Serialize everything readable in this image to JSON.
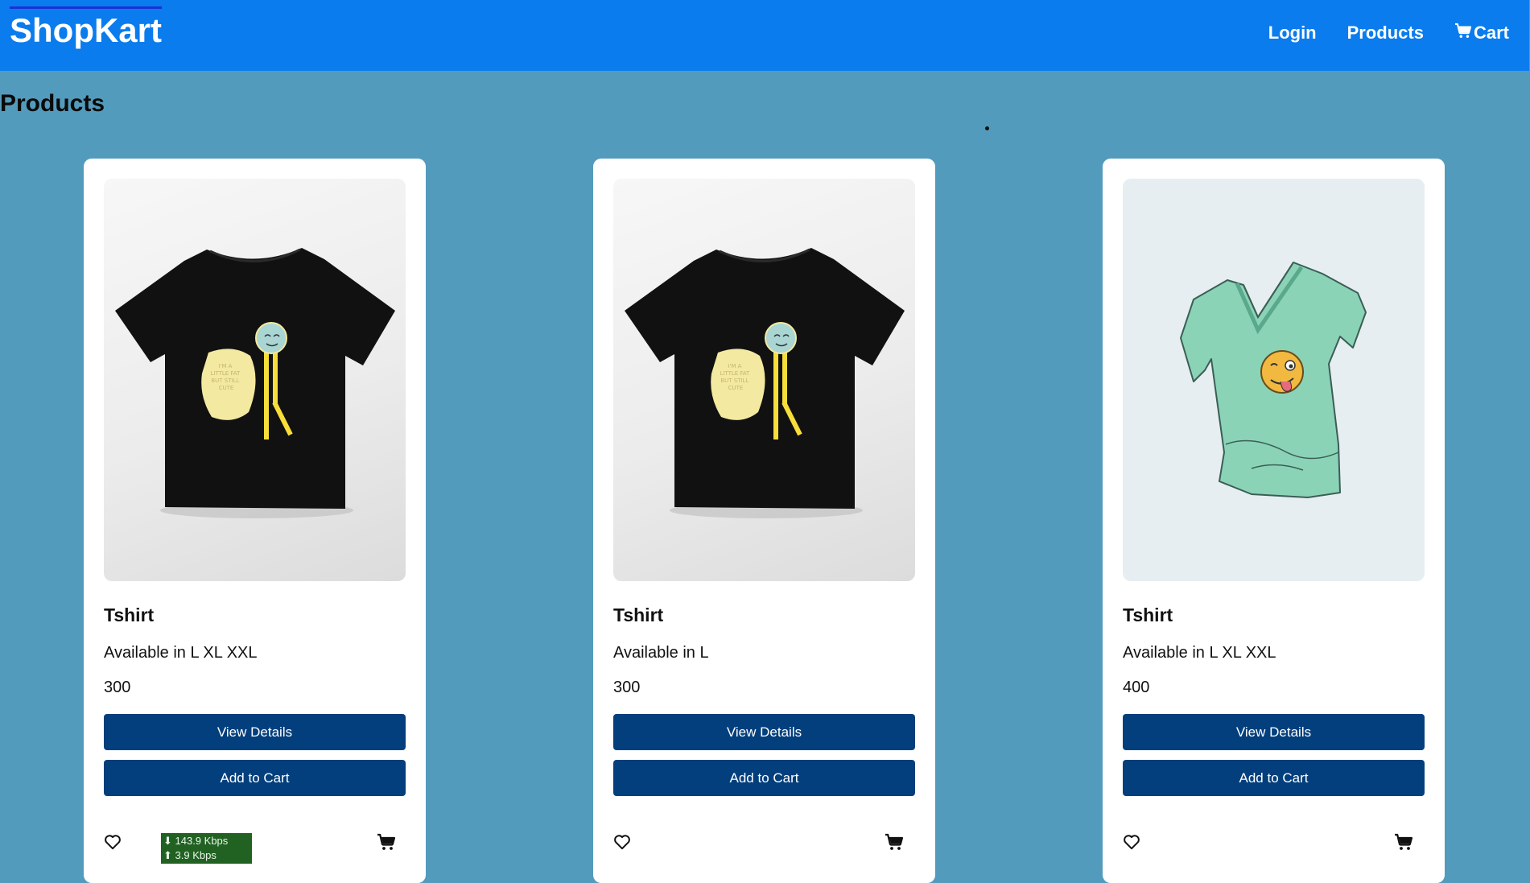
{
  "navbar": {
    "brand": "ShopKart",
    "links": {
      "login": "Login",
      "products": "Products",
      "cart": "Cart"
    }
  },
  "page_title": "Products",
  "products": [
    {
      "name": "Tshirt",
      "description": "Available in L XL XXL",
      "price": "300",
      "view_label": "View Details",
      "cart_label": "Add to Cart"
    },
    {
      "name": "Tshirt",
      "description": "Available in L",
      "price": "300",
      "view_label": "View Details",
      "cart_label": "Add to Cart"
    },
    {
      "name": "Tshirt",
      "description": "Available in L XL XXL",
      "price": "400",
      "view_label": "View Details",
      "cart_label": "Add to Cart"
    }
  ],
  "speed_widget": {
    "down": "⬇ 143.9 Kbps",
    "up": "⬆ 3.9 Kbps"
  },
  "shirt_print_text": "I'M A LITTLE FAT BUT STILL CUTE",
  "colors": {
    "navbar": "#0a7ced",
    "background": "#539bbd",
    "button": "#033f7d",
    "speed_widget": "#216223"
  },
  "icons": [
    "cart-icon",
    "heart-icon",
    "cart-icon"
  ]
}
